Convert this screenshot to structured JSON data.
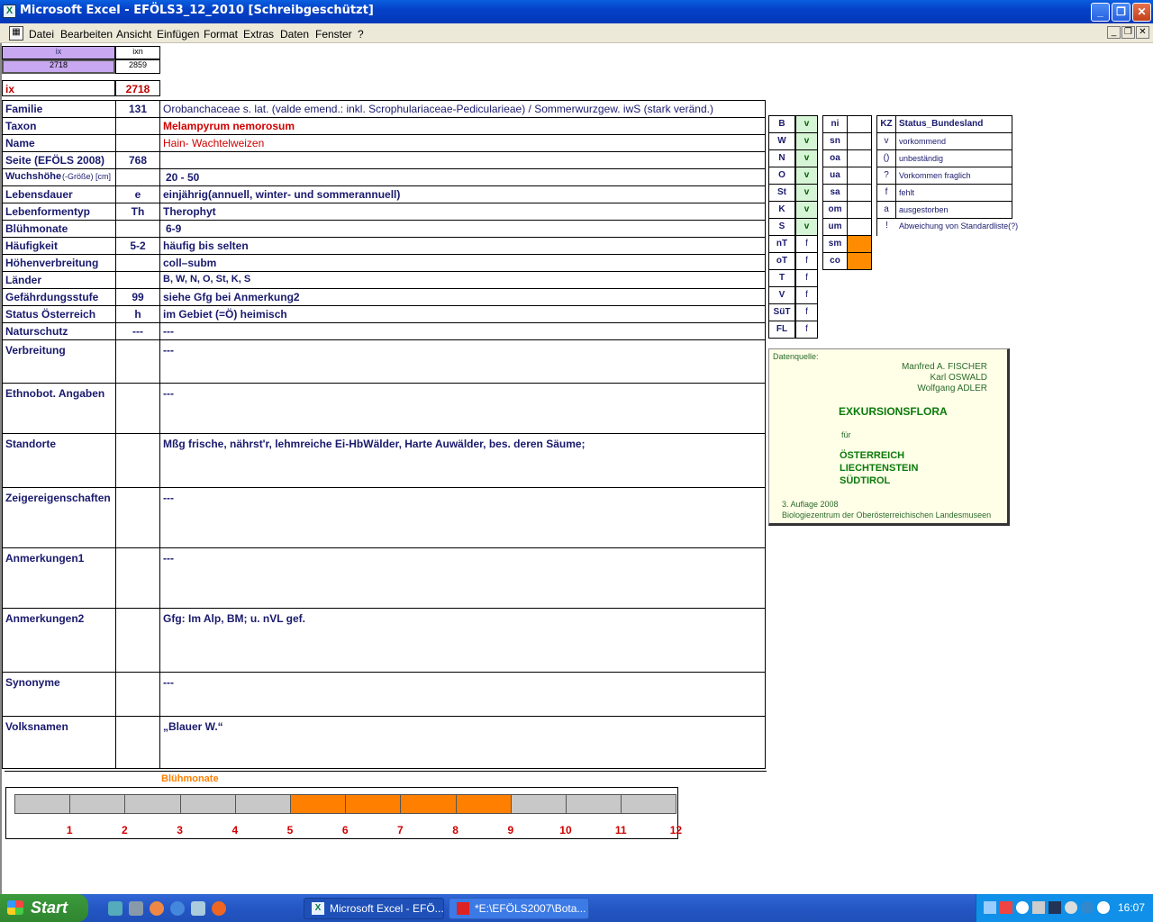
{
  "window": {
    "title": "Microsoft Excel - EFÖLS3_12_2010  [Schreibgeschützt]"
  },
  "menu": [
    "Datei",
    "Bearbeiten",
    "Ansicht",
    "Einfügen",
    "Format",
    "Extras",
    "Daten",
    "Fenster",
    "?"
  ],
  "topcells": {
    "ix_h": "ix",
    "ixn_h": "ixn",
    "ix_v": "2718",
    "ixn_v": "2859",
    "ix_label": "ix",
    "ix_value": "2718"
  },
  "rows": [
    {
      "label": "Familie",
      "num": "131",
      "value": "Orobanchaceae s. lat. (valde emend.: inkl. Scrophulariaceae-Pedicularieae)  /  Sommerwurzgew. iwS (stark veränd.)"
    },
    {
      "label": "Taxon",
      "num": "",
      "value": "Melampyrum nemorosum"
    },
    {
      "label": "Name",
      "num": "",
      "value": "Hain- Wachtelweizen"
    },
    {
      "label": "Seite (EFÖLS 2008)",
      "num": "768",
      "value": ""
    },
    {
      "label": "Wuchshöhe",
      "sublabel": "(-Größe) [cm]",
      "num": "",
      "value": "20 - 50"
    },
    {
      "label": "Lebensdauer",
      "num": "e",
      "value": "einjährig(annuell, winter- und sommerannuell)"
    },
    {
      "label": "Lebenformentyp",
      "num": "Th",
      "value": "Therophyt"
    },
    {
      "label": "Blühmonate",
      "num": "",
      "value": "6-9"
    },
    {
      "label": "Häufigkeit",
      "num": "5-2",
      "value": "häufig bis selten"
    },
    {
      "label": "Höhenverbreitung",
      "num": "",
      "value": "coll–subm"
    },
    {
      "label": "Länder",
      "num": "",
      "value": "B, W, N, O, St, K, S"
    },
    {
      "label": "Gefährdungsstufe",
      "num": "99",
      "value": "siehe Gfg bei Anmerkung2"
    },
    {
      "label": "Status Österreich",
      "num": "h",
      "value": "im Gebiet (=Ö) heimisch"
    },
    {
      "label": "Naturschutz",
      "num": "---",
      "value": "---"
    }
  ],
  "bigrows": [
    {
      "label": "Verbreitung",
      "value": "---"
    },
    {
      "label": "Ethnobot. Angaben",
      "value": "---"
    },
    {
      "label": "Standorte",
      "value": "Mßg frische, nährst'r, lehmreiche Ei-HbWälder, Harte Auwälder, bes. deren Säume;"
    },
    {
      "label": "Zeigereigenschaften",
      "value": "---"
    },
    {
      "label": "Anmerkungen1",
      "value": "---"
    },
    {
      "label": "Anmerkungen2",
      "value": "Gfg: Im Alp, BM; u. nVL gef."
    },
    {
      "label": "Synonyme",
      "value": "---"
    },
    {
      "label": "Volksnamen",
      "value": "„Blauer W.“"
    }
  ],
  "states": [
    {
      "code": "B",
      "v": "v"
    },
    {
      "code": "W",
      "v": "v"
    },
    {
      "code": "N",
      "v": "v"
    },
    {
      "code": "O",
      "v": "v"
    },
    {
      "code": "St",
      "v": "v"
    },
    {
      "code": "K",
      "v": "v"
    },
    {
      "code": "S",
      "v": "v"
    },
    {
      "code": "nT",
      "v": "f"
    },
    {
      "code": "oT",
      "v": "f"
    },
    {
      "code": "T",
      "v": "f"
    },
    {
      "code": "V",
      "v": "f"
    },
    {
      "code": "SüT",
      "v": "f"
    },
    {
      "code": "FL",
      "v": "f"
    }
  ],
  "alt": [
    "ni",
    "sn",
    "oa",
    "ua",
    "sa",
    "om",
    "um",
    "sm",
    "co"
  ],
  "legend": {
    "kz": "KZ",
    "status": "Status_Bundesland",
    "items": [
      {
        "k": "v",
        "t": "vorkommend"
      },
      {
        "k": "()",
        "t": "unbeständig"
      },
      {
        "k": "?",
        "t": "Vorkommen fraglich"
      },
      {
        "k": "f",
        "t": "fehlt"
      },
      {
        "k": "a",
        "t": "ausgestorben"
      },
      {
        "k": "!",
        "t": "Abweichung von Standardliste(?)"
      }
    ]
  },
  "source": {
    "head": "Datenquelle:",
    "authors": [
      "Manfred A. FISCHER",
      "Karl OSWALD",
      "Wolfgang ADLER"
    ],
    "title": "EXKURSIONSFLORA",
    "fuer": "für",
    "countries": [
      "ÖSTERREICH",
      "LIECHTENSTEIN",
      "SÜDTIROL"
    ],
    "edition": "3. Auflage 2008",
    "publisher": "Biologiezentrum der Oberösterreichischen Landesmuseen"
  },
  "bloom": {
    "title": "Blühmonate",
    "months": [
      "1",
      "2",
      "3",
      "4",
      "5",
      "6",
      "7",
      "8",
      "9",
      "10",
      "11",
      "12"
    ],
    "active": [
      6,
      7,
      8,
      9
    ],
    "color_on": "#ff8000",
    "color_off": "#c8c8c8"
  },
  "taskbar": {
    "start": "Start",
    "btn1": "Microsoft Excel - EFÖ...",
    "btn2": "*E:\\EFÖLS2007\\Bota...",
    "clock": "16:07"
  }
}
